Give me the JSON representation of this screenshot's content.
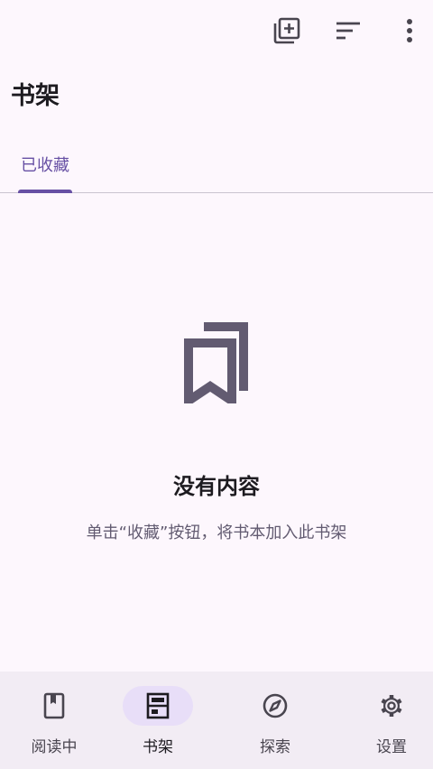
{
  "header": {
    "title": "书架",
    "actions": [
      {
        "name": "add-shelf-button",
        "icon": "library-add-icon"
      },
      {
        "name": "sort-button",
        "icon": "sort-icon"
      },
      {
        "name": "more-options-button",
        "icon": "more-vert-icon"
      }
    ]
  },
  "tabs": [
    {
      "label": "已收藏",
      "selected": true
    }
  ],
  "empty": {
    "icon": "bookmarks-icon",
    "title": "没有内容",
    "hint": "单击“收藏”按钮，将书本加入此书架"
  },
  "nav": {
    "items": [
      {
        "label": "阅读中",
        "icon": "book-icon",
        "selected": false
      },
      {
        "label": "书架",
        "icon": "shelf-icon",
        "selected": true
      },
      {
        "label": "探索",
        "icon": "compass-icon",
        "selected": false
      },
      {
        "label": "设置",
        "icon": "gear-icon",
        "selected": false
      }
    ]
  },
  "colors": {
    "background": "#fdf7fd",
    "accent": "#6750a4",
    "nav_background": "#f2ecf4",
    "nav_active_pill": "#e8def8"
  }
}
